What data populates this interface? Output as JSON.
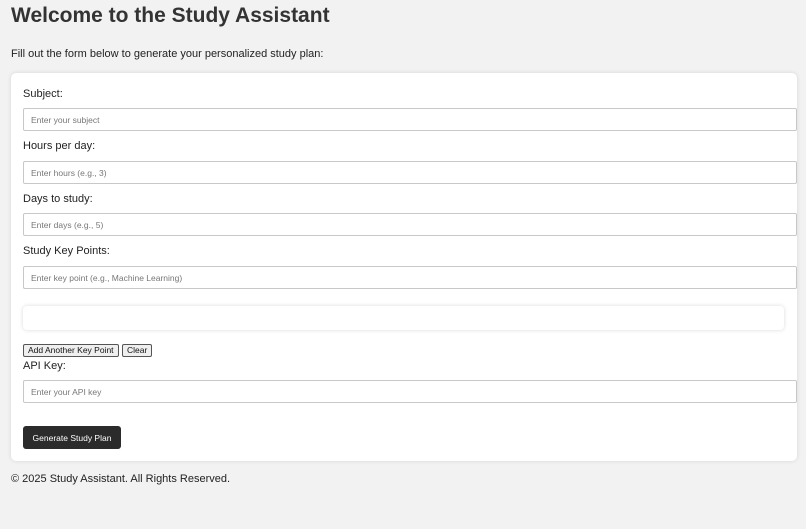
{
  "header": {
    "title": "Welcome to the Study Assistant",
    "intro": "Fill out the form below to generate your personalized study plan:"
  },
  "form": {
    "subject": {
      "label": "Subject:",
      "placeholder": "Enter your subject",
      "value": ""
    },
    "hours": {
      "label": "Hours per day:",
      "placeholder": "Enter hours (e.g., 3)",
      "value": ""
    },
    "days": {
      "label": "Days to study:",
      "placeholder": "Enter days (e.g., 5)",
      "value": ""
    },
    "key_points": {
      "label": "Study Key Points:",
      "placeholder": "Enter key point (e.g., Machine Learning)",
      "value": "",
      "add_button": "Add Another Key Point",
      "clear_button": "Clear"
    },
    "api_key": {
      "label": "API Key:",
      "placeholder": "Enter your API key",
      "value": ""
    },
    "submit_label": "Generate Study Plan"
  },
  "footer": {
    "text": "© 2025 Study Assistant. All Rights Reserved."
  },
  "colors": {
    "background": "#f2f2f2",
    "card": "#ffffff",
    "primary_button": "#2b2b2b"
  }
}
